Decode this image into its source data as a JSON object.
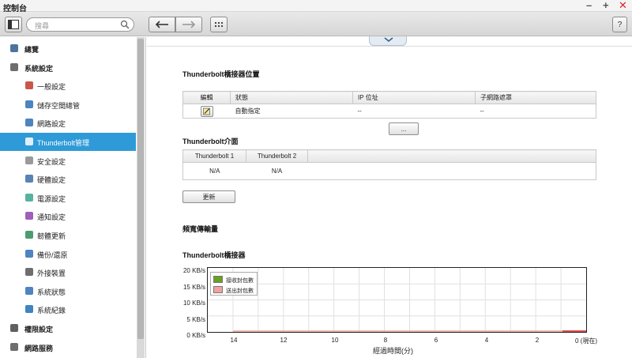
{
  "window": {
    "title": "控制台"
  },
  "toolbar": {
    "search_placeholder": "搜尋",
    "help_label": "?"
  },
  "sidebar": {
    "items": [
      {
        "label": "總覽",
        "icon": "overview-icon",
        "level": 0
      },
      {
        "label": "系統設定",
        "icon": "gear-icon",
        "level": 0
      },
      {
        "label": "一般設定",
        "icon": "general-settings-icon",
        "level": 1
      },
      {
        "label": "儲存空間總管",
        "icon": "storage-icon",
        "level": 1
      },
      {
        "label": "網路設定",
        "icon": "network-icon",
        "level": 1
      },
      {
        "label": "Thunderbolt管理",
        "icon": "thunderbolt-icon",
        "level": 1,
        "active": true
      },
      {
        "label": "安全設定",
        "icon": "lock-icon",
        "level": 1
      },
      {
        "label": "硬體設定",
        "icon": "hardware-icon",
        "level": 1
      },
      {
        "label": "電源設定",
        "icon": "power-bulb-icon",
        "level": 1
      },
      {
        "label": "通知設定",
        "icon": "notification-icon",
        "level": 1
      },
      {
        "label": "韌體更新",
        "icon": "firmware-update-icon",
        "level": 1
      },
      {
        "label": "備份/還原",
        "icon": "backup-icon",
        "level": 1
      },
      {
        "label": "外接裝置",
        "icon": "external-device-icon",
        "level": 1
      },
      {
        "label": "系統狀態",
        "icon": "monitor-icon",
        "level": 1
      },
      {
        "label": "系統紀錄",
        "icon": "log-icon",
        "level": 1
      },
      {
        "label": "權限設定",
        "icon": "user-icon",
        "level": 0
      },
      {
        "label": "網路服務",
        "icon": "globe-icon",
        "level": 0
      }
    ]
  },
  "location_section": {
    "title": "Thunderbolt橋接器位置",
    "columns": [
      "編輯",
      "狀態",
      "IP 位址",
      "子網路遮罩"
    ],
    "row": {
      "status": "自動指定",
      "ip": "--",
      "mask": "--"
    },
    "more_button": "..."
  },
  "interface_section": {
    "title": "Thunderbolt介面",
    "columns": [
      "Thunderbolt 1",
      "Thunderbolt 2"
    ],
    "values": [
      "N/A",
      "N/A"
    ],
    "update_button": "更新"
  },
  "bandwidth_section": {
    "title": "頻寬傳輸量"
  },
  "chart_section": {
    "title": "Thunderbolt橋接器"
  },
  "chart_data": {
    "type": "line",
    "title": "Thunderbolt橋接器",
    "xlabel": "經過時間(分)",
    "ylabel": "",
    "y_ticks": [
      "20 KB/s",
      "15 KB/s",
      "10 KB/s",
      "5 KB/s",
      "0 KB/s"
    ],
    "x_ticks": [
      "14",
      "12",
      "10",
      "8",
      "6",
      "4",
      "2",
      "0 (現在)"
    ],
    "ylim": [
      0,
      20
    ],
    "xlim": [
      15,
      0
    ],
    "grid": true,
    "legend": "top-left",
    "series": [
      {
        "name": "接收封包數",
        "color": "#6aa121",
        "values": [
          0,
          0,
          0,
          0,
          0,
          0,
          0,
          0
        ]
      },
      {
        "name": "送出封包數",
        "color": "#f4a0a0",
        "values": [
          0,
          0,
          0,
          0,
          0,
          0,
          0,
          0
        ]
      }
    ],
    "x": [
      14,
      12,
      10,
      8,
      6,
      4,
      2,
      0
    ]
  },
  "colors": {
    "active_bg": "#2f9ad8",
    "close": "#d8232a"
  }
}
